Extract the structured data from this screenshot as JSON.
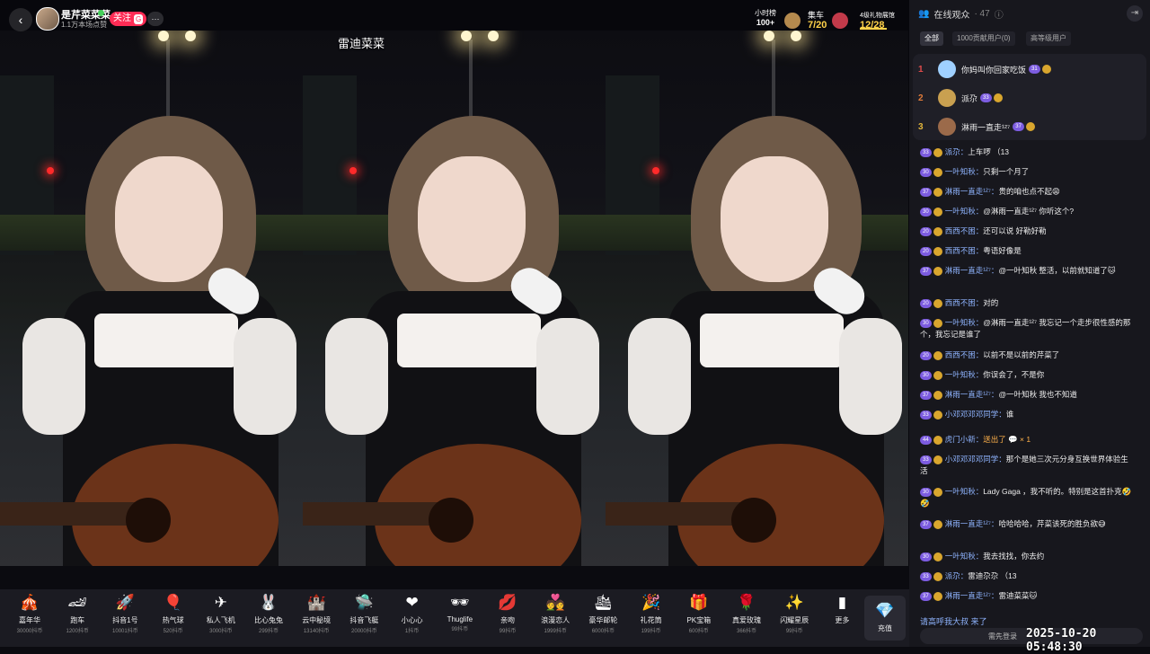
{
  "host": {
    "name": "是芹菜菜菜",
    "sub": "1.1万本场点赞",
    "follow": "关注",
    "follow_badge": "G",
    "more": "···"
  },
  "watermark": "雷迪菜菜",
  "stats": [
    {
      "label": "小时榜",
      "value": "100+"
    },
    {
      "label": "集车",
      "value": "7/20"
    },
    {
      "label": "4级礼物展馆",
      "value": "12/28"
    }
  ],
  "gifts": [
    {
      "name": "嘉年华",
      "price": "30000抖币",
      "icon": "car-icon",
      "glyph": "🎪"
    },
    {
      "name": "跑车",
      "price": "1200抖币",
      "icon": "sportscar-icon",
      "glyph": "🏎"
    },
    {
      "name": "抖音1号",
      "price": "10001抖币",
      "icon": "rocket-icon",
      "glyph": "🚀"
    },
    {
      "name": "热气球",
      "price": "520抖币",
      "icon": "balloon-icon",
      "glyph": "🎈"
    },
    {
      "name": "私人飞机",
      "price": "3000抖币",
      "icon": "plane-icon",
      "glyph": "✈"
    },
    {
      "name": "比心兔兔",
      "price": "299抖币",
      "icon": "rabbit-icon",
      "glyph": "🐰"
    },
    {
      "name": "云中秘境",
      "price": "13140抖币",
      "icon": "castle-icon",
      "glyph": "🏰"
    },
    {
      "name": "抖音飞艇",
      "price": "20000抖币",
      "icon": "airship-icon",
      "glyph": "🛸"
    },
    {
      "name": "小心心",
      "price": "1抖币",
      "icon": "heart-icon",
      "glyph": "❤"
    },
    {
      "name": "Thuglife",
      "price": "99抖币",
      "icon": "glasses-icon",
      "glyph": "🕶"
    },
    {
      "name": "亲吻",
      "price": "99抖币",
      "icon": "kiss-icon",
      "glyph": "💋"
    },
    {
      "name": "浪漫恋人",
      "price": "1999抖币",
      "icon": "couple-icon",
      "glyph": "💑"
    },
    {
      "name": "豪华邮轮",
      "price": "6000抖币",
      "icon": "ship-icon",
      "glyph": "🛳"
    },
    {
      "name": "礼花筒",
      "price": "199抖币",
      "icon": "firework-icon",
      "glyph": "🎉"
    },
    {
      "name": "PK宝箱",
      "price": "600抖币",
      "icon": "chest-icon",
      "glyph": "🎁"
    },
    {
      "name": "真爱玫瑰",
      "price": "366抖币",
      "icon": "rose-icon",
      "glyph": "🌹"
    },
    {
      "name": "闪耀星辰",
      "price": "99抖币",
      "icon": "star-icon",
      "glyph": "✨"
    },
    {
      "name": "更多",
      "price": "",
      "icon": "more-gift-icon",
      "glyph": "▮"
    }
  ],
  "recharge": {
    "label": "充值",
    "icon": "diamond-icon",
    "glyph": "💎"
  },
  "side": {
    "title": "在线观众",
    "count": "· 47",
    "tabs": [
      "全部",
      "1000贡献用户(0)",
      "高等级用户"
    ],
    "ranks": [
      {
        "no": "1",
        "name": "你妈叫你回家吃饭",
        "lv": "31",
        "color": "#e04b4b"
      },
      {
        "no": "2",
        "name": "派尕",
        "lv": "33",
        "color": "#e07b3a"
      },
      {
        "no": "3",
        "name": "淋雨一直走¹²⁷",
        "lv": "37",
        "color": "#e0b43a"
      }
    ],
    "chat": [
      {
        "lv": "33",
        "name": "派尕：",
        "text": "上车啰 （13"
      },
      {
        "lv": "30",
        "name": "一叶知秋：",
        "text": "只剩一个月了"
      },
      {
        "lv": "37",
        "name": "淋雨一直走¹²⁷：",
        "text": "贵的咱也点不起😩"
      },
      {
        "lv": "30",
        "name": "一叶知秋：",
        "text": "@淋雨一直走¹²⁷ 你听这个?"
      },
      {
        "lv": "20",
        "name": "西西不困：",
        "text": "还可以说 好勒好勒"
      },
      {
        "lv": "20",
        "name": "西西不困：",
        "text": "粤语好像是"
      },
      {
        "lv": "37",
        "name": "淋雨一直走¹²⁷：",
        "text": "@一叶知秋 整活，以前就知道了🐱"
      },
      {
        "lv": "20",
        "name": "西西不困：",
        "text": "对的"
      },
      {
        "lv": "30",
        "name": "一叶知秋：",
        "text": "@淋雨一直走¹²⁷ 我忘记一个走步很性感的那个，我忘记是谁了"
      },
      {
        "lv": "20",
        "name": "西西不困：",
        "text": "以前不是以前的芹菜了"
      },
      {
        "lv": "30",
        "name": "一叶知秋：",
        "text": "你误会了，不是你"
      },
      {
        "lv": "37",
        "name": "淋雨一直走¹²⁷：",
        "text": "@一叶知秋 我也不知道"
      },
      {
        "lv": "33",
        "name": "小邓邓邓邓同学：",
        "text": "谁"
      },
      {
        "lv": "44",
        "name": "虎门小新：",
        "text": "送出了 💬 × 1",
        "gift": true
      },
      {
        "lv": "33",
        "name": "小邓邓邓邓同学：",
        "text": "那个是她三次元分身互换世界体验生活"
      },
      {
        "lv": "30",
        "name": "一叶知秋：",
        "text": "Lady Gaga ，我不听的。特别是这首扑克🤣🤣"
      },
      {
        "lv": "37",
        "name": "淋雨一直走¹²⁷：",
        "text": "哈哈哈哈，芹菜该死的胜负欲😅"
      },
      {
        "lv": "30",
        "name": "一叶知秋：",
        "text": "我去找找，你去约"
      },
      {
        "lv": "33",
        "name": "派尕：",
        "text": "雷迪尕尕 （13"
      },
      {
        "lv": "37",
        "name": "淋雨一直走¹²⁷：",
        "text": "雷迪菜菜🐱"
      }
    ],
    "tail": "请高呼我大叔 来了",
    "input_placeholder": "需先登录",
    "timestamp": "2025-10-20 05:48:30"
  }
}
